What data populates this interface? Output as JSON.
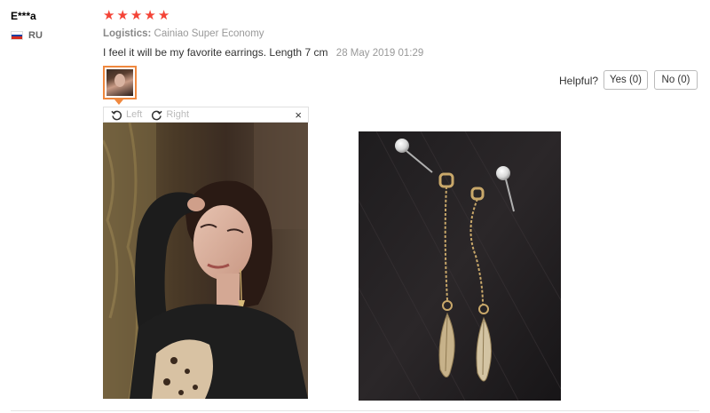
{
  "review": {
    "user_name": "E***a",
    "country_code": "RU",
    "stars": 5,
    "logistics_label": "Logistics:",
    "logistics_value": "Cainiao Super Economy",
    "text": "I feel it will be my favorite earrings. Length 7 cm",
    "date": "28 May 2019 01:29"
  },
  "helpful": {
    "label": "Helpful?",
    "yes": "Yes (0)",
    "no": "No (0)"
  },
  "viewer": {
    "rotate_left": "Left",
    "rotate_right": "Right",
    "close_symbol": "×"
  },
  "colors": {
    "star": "#f44336",
    "thumb_border": "#f0883e"
  }
}
